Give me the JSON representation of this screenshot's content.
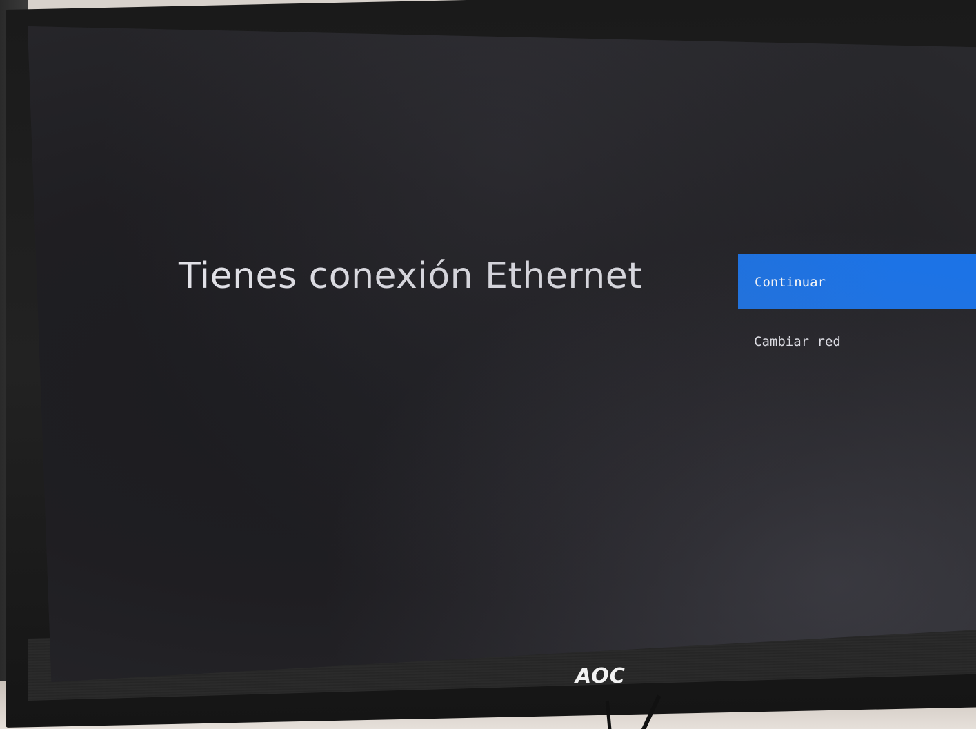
{
  "setup_screen": {
    "title": "Tienes conexión Ethernet",
    "options": {
      "continue_label": "Continuar",
      "change_network_label": "Cambiar red"
    },
    "selected_option": "Continuar"
  },
  "monitor": {
    "brand": "AOC"
  },
  "colors": {
    "accent": "#1a73e8",
    "screen_background": "#222226",
    "text": "#e6e6ec"
  }
}
